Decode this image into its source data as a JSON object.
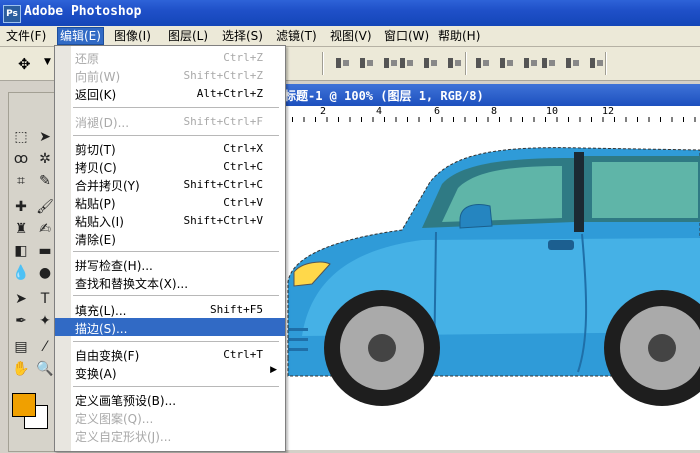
{
  "app": {
    "title": "Adobe Photoshop",
    "logo_letters": "Ps"
  },
  "menubar": {
    "items": [
      {
        "label": "文件(F)"
      },
      {
        "label": "编辑(E)"
      },
      {
        "label": "图像(I)"
      },
      {
        "label": "图层(L)"
      },
      {
        "label": "选择(S)"
      },
      {
        "label": "滤镜(T)"
      },
      {
        "label": "视图(V)"
      },
      {
        "label": "窗口(W)"
      },
      {
        "label": "帮助(H)"
      }
    ]
  },
  "document": {
    "title": "标题-1 @ 100% (图层 1, RGB/8)",
    "ruler_labels": [
      "2",
      "4",
      "6",
      "8",
      "10",
      "12"
    ]
  },
  "colors": {
    "foreground": "#f0a000",
    "background": "#ffffff",
    "accent": "#316ac5"
  },
  "edit_menu": {
    "items": [
      {
        "label": "还原",
        "shortcut": "Ctrl+Z",
        "disabled": true
      },
      {
        "label": "向前(W)",
        "shortcut": "Shift+Ctrl+Z",
        "disabled": true
      },
      {
        "label": "返回(K)",
        "shortcut": "Alt+Ctrl+Z",
        "disabled": false
      },
      {
        "label": "消褪(D)...",
        "shortcut": "Shift+Ctrl+F",
        "disabled": true
      },
      {
        "label": "剪切(T)",
        "shortcut": "Ctrl+X",
        "disabled": false
      },
      {
        "label": "拷贝(C)",
        "shortcut": "Ctrl+C",
        "disabled": false
      },
      {
        "label": "合并拷贝(Y)",
        "shortcut": "Shift+Ctrl+C",
        "disabled": false
      },
      {
        "label": "粘贴(P)",
        "shortcut": "Ctrl+V",
        "disabled": false
      },
      {
        "label": "粘贴入(I)",
        "shortcut": "Shift+Ctrl+V",
        "disabled": false
      },
      {
        "label": "清除(E)",
        "shortcut": "",
        "disabled": false
      },
      {
        "label": "拼写检查(H)...",
        "shortcut": "",
        "disabled": false
      },
      {
        "label": "查找和替换文本(X)...",
        "shortcut": "",
        "disabled": false
      },
      {
        "label": "填充(L)...",
        "shortcut": "Shift+F5",
        "disabled": false
      },
      {
        "label": "描边(S)...",
        "shortcut": "",
        "disabled": false,
        "highlighted": true
      },
      {
        "label": "自由变换(F)",
        "shortcut": "Ctrl+T",
        "disabled": false
      },
      {
        "label": "变换(A)",
        "shortcut": "",
        "disabled": false,
        "submenu": true
      },
      {
        "label": "定义画笔预设(B)...",
        "shortcut": "",
        "disabled": false
      },
      {
        "label": "定义图案(Q)...",
        "shortcut": "",
        "disabled": true
      },
      {
        "label": "定义自定形状(J)...",
        "shortcut": "",
        "disabled": true
      }
    ]
  }
}
